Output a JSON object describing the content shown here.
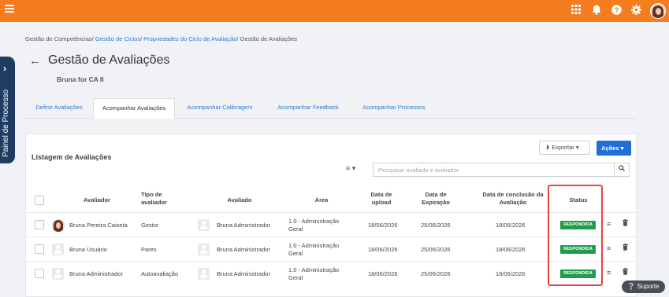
{
  "topbar": {
    "color": "#f57c1f",
    "icons": [
      "menu-icon",
      "apps-grid-icon",
      "bell-icon",
      "help-icon",
      "gear-icon",
      "user-avatar"
    ]
  },
  "side_panel": {
    "label": "Painel de Processo",
    "color": "#1f3c62"
  },
  "breadcrumb": {
    "items": [
      "Gestão de Competências",
      "Gestão de Ciclos",
      "Propriedades do Ciclo de Avaliação",
      "Gestão de Avaliações"
    ],
    "separator": "/"
  },
  "header": {
    "title": "Gestão de Avaliações",
    "subtitle": "Bruna for CA II"
  },
  "tabs": [
    {
      "label": "Definir Avaliações",
      "active": false
    },
    {
      "label": "Acompanhar Avaliações",
      "active": true
    },
    {
      "label": "Acompanhar Calibragem",
      "active": false
    },
    {
      "label": "Acompanhar Feedback",
      "active": false
    },
    {
      "label": "Acompanhar Processos",
      "active": false
    }
  ],
  "card": {
    "title": "Listagem de Avaliações",
    "export_label": "Exportar",
    "actions_label": "Ações",
    "search_placeholder": "Pesquisar avaliado e avaliador"
  },
  "table": {
    "headers": {
      "avaliador": "Avaliador",
      "tipo": [
        "Tipo de",
        "avaliador"
      ],
      "avaliado": "Avaliado",
      "area": "Área",
      "upload": [
        "Data de",
        "upload"
      ],
      "expiracao": [
        "Data de",
        "Expiração"
      ],
      "conclusao": [
        "Data de conclusão da",
        "Avaliação"
      ],
      "status": "Status"
    },
    "rows": [
      {
        "avaliador": "Bruna Pereira Caixeta",
        "tipo": "Gestor",
        "avaliado": "Bruna Administrador",
        "area": [
          "1.0 - Administração",
          "Geral"
        ],
        "upload": "18/06/2026",
        "expiracao": "25/06/2026",
        "conclusao": "18/06/2026",
        "status": "RESPONDIDA"
      },
      {
        "avaliador": "Bruna Usuário",
        "tipo": "Pares",
        "avaliado": "Bruna Administrador",
        "area": [
          "1.0 - Administração",
          "Geral"
        ],
        "upload": "18/06/2026",
        "expiracao": "25/06/2026",
        "conclusao": "18/06/2026",
        "status": "RESPONDIDA"
      },
      {
        "avaliador": "Bruna Administrador",
        "tipo": "Autoavaliação",
        "avaliado": "Bruna Administrador",
        "area": [
          "1.0 - Administração",
          "Geral"
        ],
        "upload": "18/06/2026",
        "expiracao": "25/06/2026",
        "conclusao": "18/06/2026",
        "status": "RESPONDIDA"
      }
    ],
    "status_color": "#1e9d4a",
    "highlight_color": "#e04848"
  },
  "support": {
    "label": "Suporte"
  },
  "accent": "#1f6fd6"
}
